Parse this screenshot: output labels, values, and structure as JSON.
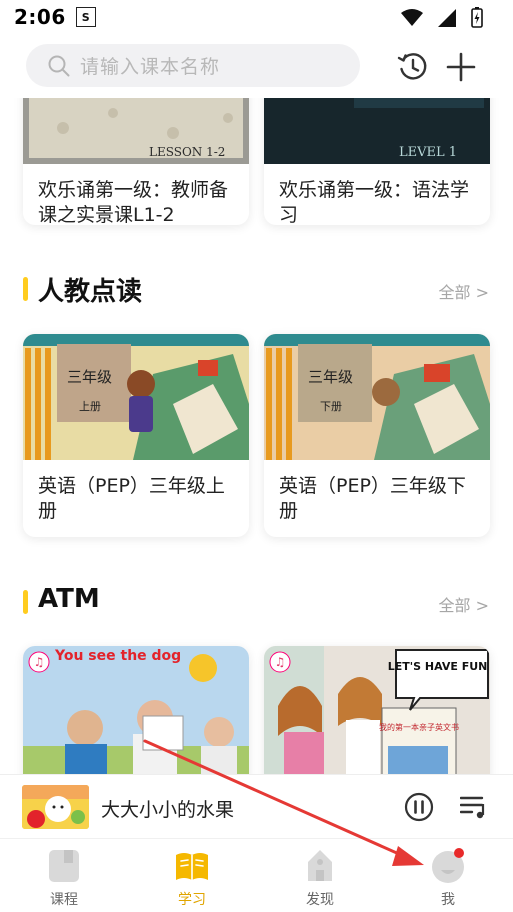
{
  "status_bar": {
    "time": "2:06",
    "app_icon_text": "S"
  },
  "search": {
    "placeholder": "请输入课本名称"
  },
  "top_cards": [
    {
      "title": "欢乐诵第一级：教师备课之实景课L1-2",
      "cover_text": "LESSON 1-2"
    },
    {
      "title": "欢乐诵第一级：语法学习",
      "cover_text": "LEVEL 1"
    }
  ],
  "sections": [
    {
      "title": "人教点读",
      "all_label": "全部 >",
      "cards": [
        {
          "title": "英语（PEP）三年级上册",
          "cover_grade": "三年级",
          "cover_volume": "上册"
        },
        {
          "title": "英语（PEP）三年级下册",
          "cover_grade": "三年级",
          "cover_volume": "下册"
        }
      ]
    },
    {
      "title": "ATM",
      "all_label": "全部 >",
      "cards": [
        {
          "cover_text": "You see the dog"
        },
        {
          "cover_text": "LET'S HAVE FUN !",
          "book_text": "我的第一本亲子英文书"
        }
      ]
    }
  ],
  "player": {
    "title": "大大小小的水果"
  },
  "tabs": [
    {
      "label": "课程",
      "active": false
    },
    {
      "label": "学习",
      "active": true
    },
    {
      "label": "发现",
      "active": false
    },
    {
      "label": "我",
      "active": false,
      "badge": true
    }
  ],
  "colors": {
    "accent": "#ffcc1f",
    "active_tab": "#e0a500",
    "badge": "#e82a2a",
    "annotation_arrow": "#e53935"
  }
}
